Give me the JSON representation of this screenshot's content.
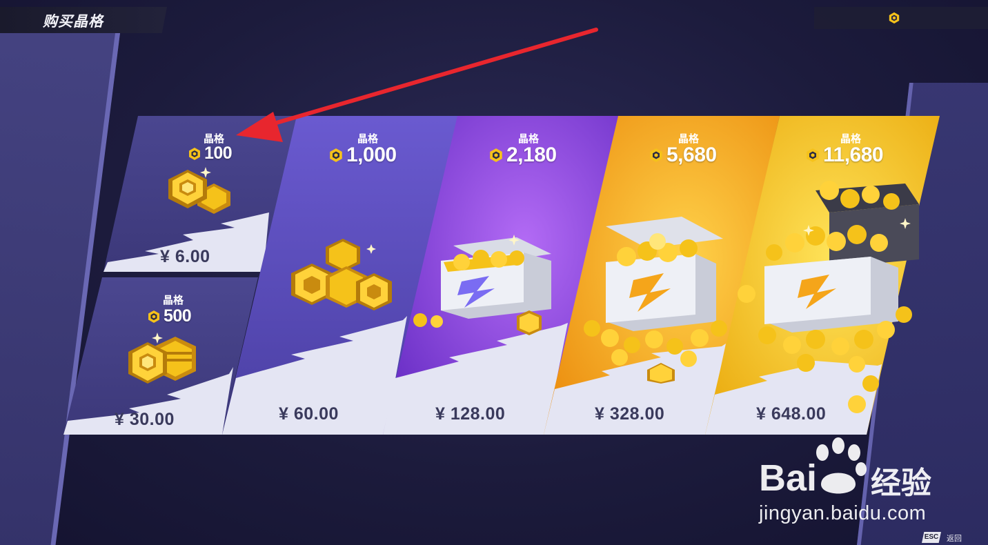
{
  "header": {
    "title": "购买晶格"
  },
  "top_bar": {
    "currency_icon": "crystal-coin-icon"
  },
  "packages": [
    {
      "title": "晶格",
      "amount": "100",
      "price": "¥ 6.00"
    },
    {
      "title": "晶格",
      "amount": "500",
      "price": "¥ 30.00"
    },
    {
      "title": "晶格",
      "amount": "1,000",
      "price": "¥ 60.00"
    },
    {
      "title": "晶格",
      "amount": "2,180",
      "price": "¥ 128.00"
    },
    {
      "title": "晶格",
      "amount": "5,680",
      "price": "¥ 328.00"
    },
    {
      "title": "晶格",
      "amount": "11,680",
      "price": "¥ 648.00"
    }
  ],
  "footer": {
    "esc_key": "ESC",
    "esc_label": "返回"
  },
  "watermark": {
    "brand": "Bai",
    "brand_cn": "经验",
    "url": "jingyan.baidu.com"
  },
  "colors": {
    "accent_gold": "#f5c21a",
    "annotation_arrow": "#e8262e"
  }
}
